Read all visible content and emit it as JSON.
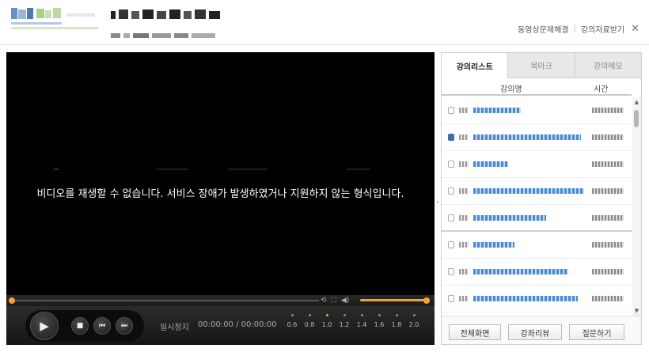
{
  "header": {
    "link_troubleshoot": "동영상문제해결",
    "link_materials": "강의자료받기",
    "close_glyph": "✕"
  },
  "player": {
    "error_message": "비디오를 재생할 수 없습니다. 서비스 장애가 발생하였거나 지원하지 않는 형식입니다.",
    "status": "일시정지",
    "time": "00:00:00 / 00:00:00",
    "speeds": [
      "0.6",
      "0.8",
      "1.0",
      "1.2",
      "1.4",
      "1.6",
      "1.8",
      "2.0"
    ],
    "active_speed": "1.0",
    "progress": 0,
    "volume": 1.0,
    "icons": {
      "play": "▶",
      "stop": "■",
      "prev": "⏮",
      "next": "⏭"
    }
  },
  "sidebar": {
    "tabs": [
      "강의리스트",
      "북마크",
      "강의메모"
    ],
    "active_tab": 0,
    "columns": {
      "name": "강의명",
      "time": "시간"
    },
    "buttons": {
      "fullscreen": "전체화면",
      "review": "강좌리뷰",
      "question": "질문하기"
    }
  },
  "colors": {
    "accent": "#f2a334",
    "link_blue": "#4a8ad4",
    "player_bg": "#000000"
  }
}
